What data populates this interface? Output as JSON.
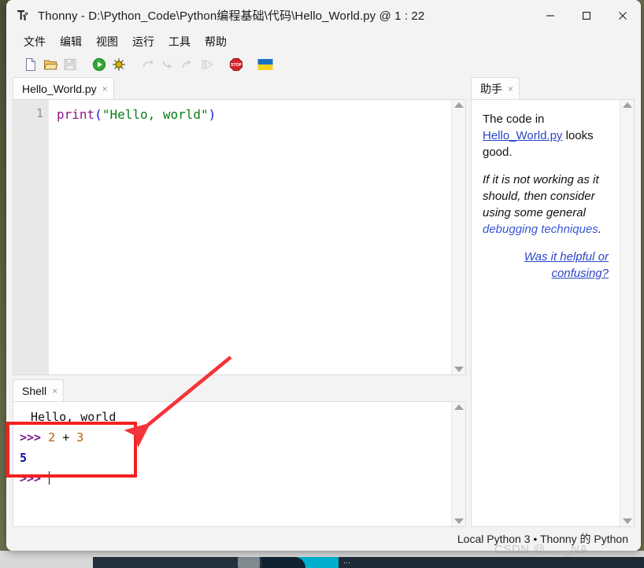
{
  "window": {
    "app_name": "Thonny",
    "title": "Thonny  -  D:\\Python_Code\\Python编程基础\\代码\\Hello_World.py  @  1 : 22",
    "app_icon": "thonny-icon",
    "controls": {
      "minimize": "─",
      "maximize": "□",
      "close": "✕"
    }
  },
  "menubar": {
    "items": [
      {
        "label": "文件",
        "name": "menu-file"
      },
      {
        "label": "编辑",
        "name": "menu-edit"
      },
      {
        "label": "视图",
        "name": "menu-view"
      },
      {
        "label": "运行",
        "name": "menu-run"
      },
      {
        "label": "工具",
        "name": "menu-tools"
      },
      {
        "label": "帮助",
        "name": "menu-help"
      }
    ]
  },
  "toolbar": {
    "buttons": [
      {
        "name": "new-file-icon",
        "icon": "new-file",
        "enabled": true
      },
      {
        "name": "open-file-icon",
        "icon": "open-folder",
        "enabled": true
      },
      {
        "name": "save-file-icon",
        "icon": "floppy-save",
        "enabled": false
      },
      {
        "name": "run-icon",
        "icon": "green-play",
        "enabled": true
      },
      {
        "name": "debug-icon",
        "icon": "bug-debug",
        "enabled": true
      },
      {
        "name": "step-over-icon",
        "icon": "step-over",
        "enabled": false
      },
      {
        "name": "step-into-icon",
        "icon": "step-into",
        "enabled": false
      },
      {
        "name": "step-out-icon",
        "icon": "step-out",
        "enabled": false
      },
      {
        "name": "resume-icon",
        "icon": "resume",
        "enabled": false
      },
      {
        "name": "stop-icon",
        "icon": "stop-sign",
        "enabled": true
      },
      {
        "name": "ukraine-flag-icon",
        "icon": "ukraine-flag",
        "enabled": true
      }
    ],
    "stop_label": "STOP"
  },
  "editor": {
    "tab_label": "Hello_World.py",
    "tab_close": "×",
    "line_numbers": [
      "1"
    ],
    "code": {
      "fn": "print",
      "open_paren": "(",
      "string": "\"Hello, world\"",
      "close_paren": ")"
    }
  },
  "shell": {
    "tab_label": "Shell",
    "tab_close": "×",
    "lines": [
      {
        "type": "output",
        "text": "Hello, world"
      },
      {
        "type": "input",
        "prompt": ">>>",
        "expr_a": "2",
        "op": "+",
        "expr_b": "3"
      },
      {
        "type": "result",
        "text": "5"
      },
      {
        "type": "prompt",
        "prompt": ">>>",
        "text": ""
      }
    ]
  },
  "assistant": {
    "tab_label": "助手",
    "tab_close": "×",
    "para1_before": "The code in ",
    "para1_link": "Hello_World.py",
    "para1_after": " looks good.",
    "para2_before": "If it is not working as it should, then consider using some general ",
    "para2_link": "debugging techniques",
    "para2_after": ".",
    "feedback_link": "Was it helpful or confusing?"
  },
  "statusbar": {
    "text": "Local Python 3  •  Thonny 的 Python"
  },
  "watermark": {
    "text": "CSDN @..., _NA"
  },
  "annotation": {
    "box_color": "#f32020",
    "arrow_color": "#f5333a",
    "highlighted_region": "shell-expression-2-plus-3-result-5"
  },
  "taskbar": {
    "label": "..."
  },
  "colors": {
    "accent_purple": "#7d1a8c",
    "string_green": "#0a7d18",
    "paren_blue": "#1414d6",
    "number_orange": "#b85c00",
    "result_blue": "#0b0bb0",
    "link_blue": "#2b45c9",
    "annotation_red": "#f32020"
  }
}
